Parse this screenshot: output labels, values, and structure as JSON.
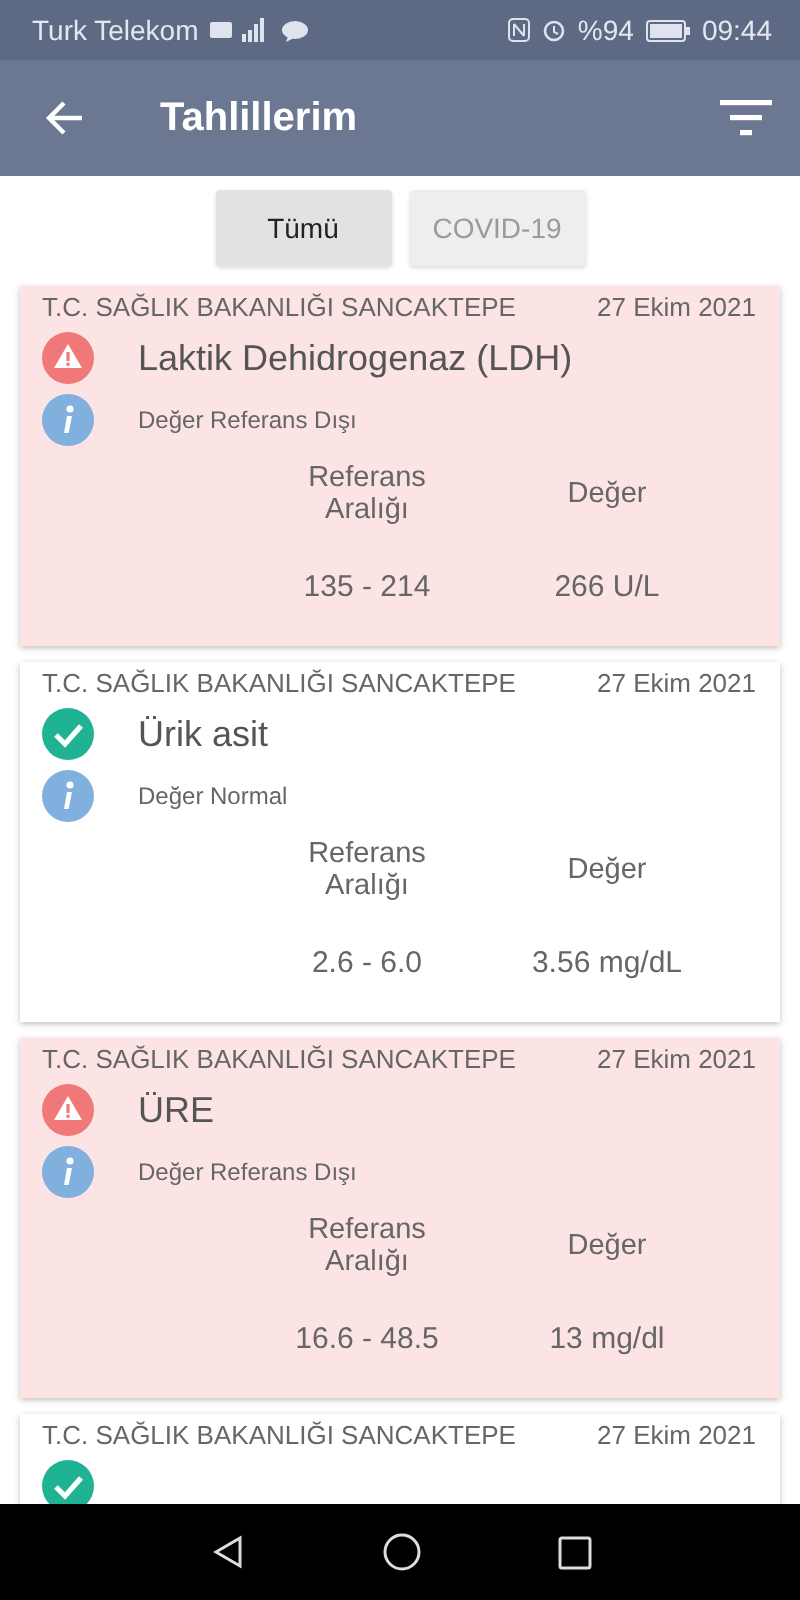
{
  "status_bar": {
    "carrier": "Turk Telekom",
    "battery": "%94",
    "time": "09:44"
  },
  "app_bar": {
    "title": "Tahlillerim"
  },
  "filters": [
    {
      "label": "Tümü",
      "selected": true
    },
    {
      "label": "COVID-19",
      "selected": false
    }
  ],
  "results": [
    {
      "institution": "T.C. SAĞLIK BAKANLIĞI SANCAKTEPE",
      "date": "27 Ekim 2021",
      "out_of_range": true,
      "test": "Laktik Dehidrogenaz (LDH)",
      "note": "Değer Referans Dışı",
      "range_label": "Referans Aralığı",
      "value_label": "Değer",
      "range": "135 - 214",
      "value": "266 U/L"
    },
    {
      "institution": "T.C. SAĞLIK BAKANLIĞI SANCAKTEPE",
      "date": "27 Ekim 2021",
      "out_of_range": false,
      "test": "Ürik asit",
      "note": "Değer Normal",
      "range_label": "Referans Aralığı",
      "value_label": "Değer",
      "range": "2.6 - 6.0",
      "value": "3.56 mg/dL"
    },
    {
      "institution": "T.C. SAĞLIK BAKANLIĞI SANCAKTEPE",
      "date": "27 Ekim 2021",
      "out_of_range": true,
      "test": "ÜRE",
      "note": "Değer Referans Dışı",
      "range_label": "Referans Aralığı",
      "value_label": "Değer",
      "range": "16.6 - 48.5",
      "value": "13 mg/dl"
    },
    {
      "institution": "T.C. SAĞLIK BAKANLIĞI SANCAKTEPE",
      "date": "27 Ekim 2021",
      "out_of_range": false
    }
  ]
}
